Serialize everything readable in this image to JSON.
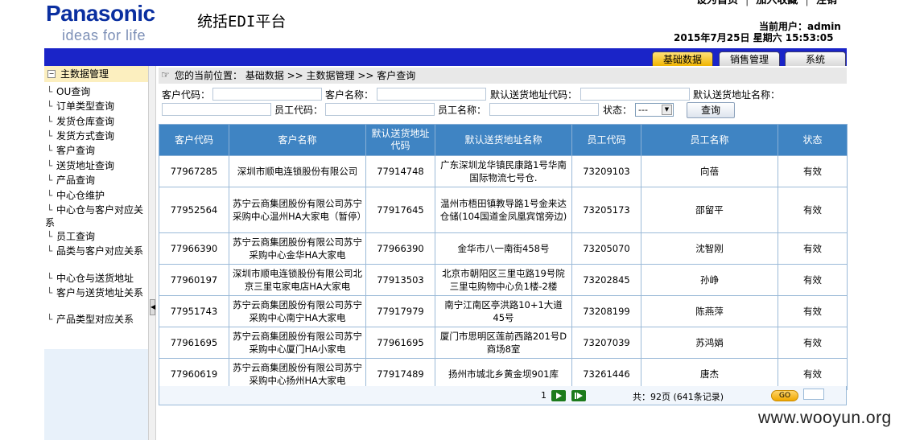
{
  "brand": {
    "logo": "Panasonic",
    "slogan": "ideas for life"
  },
  "site_title": "统括EDI平台",
  "top_links": [
    "设为首页",
    "加入收藏",
    "注销"
  ],
  "user_info": "当前用户：admin",
  "datetime": "2015年7月25日  星期六   15:53:05",
  "nav_tabs": [
    {
      "label": "基础数据",
      "active": true
    },
    {
      "label": "销售管理",
      "active": false
    },
    {
      "label": "系统",
      "active": false
    }
  ],
  "sidebar": {
    "root_toggle": "−",
    "root_label": "主数据管理",
    "items": [
      "OU查询",
      "订单类型查询",
      "发货仓库查询",
      "发货方式查询",
      "客户查询",
      "送货地址查询",
      "产品查询",
      "中心仓维护",
      "中心仓与客户对应关系",
      "员工查询",
      "品类与客户对应关系",
      "中心仓与送货地址",
      "客户与送货地址关系",
      "产品类型对应关系"
    ]
  },
  "breadcrumb": "您的当前位置：  基础数据 >> 主数据管理 >> 客户查询",
  "search": {
    "customer_code_label": "客户代码：",
    "customer_name_label": "客户名称：",
    "default_addr_code_label": "默认送货地址代码：",
    "default_addr_name_label": "默认送货地址名称：",
    "employee_code_label": "员工代码：",
    "employee_name_label": "员工名称：",
    "status_label": "状态：",
    "status_value": "---",
    "query_button": "查询"
  },
  "table": {
    "headers": [
      "客户代码",
      "客户名称",
      "默认送货地址代码",
      "默认送货地址名称",
      "员工代码",
      "员工名称",
      "状态"
    ],
    "rows": [
      [
        "77967285",
        "深圳市顺电连锁股份有限公司",
        "77914748",
        "广东深圳龙华镇民康路1号华南国际物流七号仓.",
        "73209103",
        "向蓓",
        "有效"
      ],
      [
        "77952564",
        "苏宁云商集团股份有限公司苏宁采购中心温州HA大家电（暂停）",
        "77917645",
        "温州市梧田镇教导路1号金来达仓储(104国道金凤凰宾馆旁边)",
        "73205173",
        "邵留平",
        "有效"
      ],
      [
        "77966390",
        "苏宁云商集团股份有限公司苏宁采购中心金华HA大家电",
        "77966390",
        "金华市八一南街458号",
        "73205070",
        "沈智刚",
        "有效"
      ],
      [
        "77960197",
        "深圳市顺电连锁股份有限公司北京三里屯家电店HA大家电",
        "77913503",
        "北京市朝阳区三里屯路19号院三里屯购物中心负1楼-2楼",
        "73202845",
        "孙峥",
        "有效"
      ],
      [
        "77951743",
        "苏宁云商集团股份有限公司苏宁采购中心南宁HA大家电",
        "77917979",
        "南宁江南区亭洪路10+1大道45号",
        "73208199",
        "陈燕萍",
        "有效"
      ],
      [
        "77961695",
        "苏宁云商集团股份有限公司苏宁采购中心厦门HA小家电",
        "77961695",
        "厦门市思明区莲前西路201号D商场8室",
        "73207039",
        "苏鸿娟",
        "有效"
      ],
      [
        "77960619",
        "苏宁云商集团股份有限公司苏宁采购中心扬州HA大家电",
        "77917489",
        "扬州市城北乡黄金坝901库",
        "73261446",
        "唐杰",
        "有效"
      ]
    ]
  },
  "pager": {
    "current_page": "1",
    "summary": "共：92页 (641条记录)",
    "go_label": "GO"
  },
  "watermark": "www.wooyun.org",
  "colors": {
    "nav_bar": "#1a24c8",
    "table_header": "#3f84c3",
    "active_tab": "#f0b400"
  }
}
